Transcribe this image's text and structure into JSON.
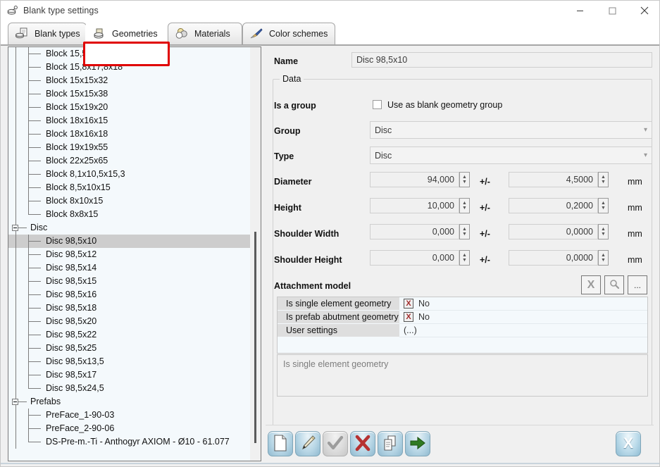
{
  "window": {
    "title": "Blank type settings",
    "icon": "blank-settings-icon",
    "minimize": "minimize-icon",
    "maximize": "maximize-icon",
    "close": "close-icon"
  },
  "tabs": [
    {
      "label": "Blank types",
      "icon": "blank-stack-icon",
      "selected": false
    },
    {
      "label": "Geometries",
      "icon": "geometry-disc-icon",
      "selected": true
    },
    {
      "label": "Materials",
      "icon": "materials-discs-icon",
      "selected": false
    },
    {
      "label": "Color schemes",
      "icon": "paintbrush-icon",
      "selected": false
    }
  ],
  "highlight_color": "#e00000",
  "tree": {
    "items": [
      {
        "label": "Block 15,5x19x39",
        "level": 1,
        "selected": false
      },
      {
        "label": "Block 15,8x17,8x18",
        "level": 1,
        "selected": false
      },
      {
        "label": "Block 15x15x32",
        "level": 1,
        "selected": false
      },
      {
        "label": "Block 15x15x38",
        "level": 1,
        "selected": false
      },
      {
        "label": "Block 15x19x20",
        "level": 1,
        "selected": false
      },
      {
        "label": "Block 18x16x15",
        "level": 1,
        "selected": false
      },
      {
        "label": "Block 18x16x18",
        "level": 1,
        "selected": false
      },
      {
        "label": "Block 19x19x55",
        "level": 1,
        "selected": false
      },
      {
        "label": "Block 22x25x65",
        "level": 1,
        "selected": false
      },
      {
        "label": "Block 8,1x10,5x15,3",
        "level": 1,
        "selected": false
      },
      {
        "label": "Block 8,5x10x15",
        "level": 1,
        "selected": false
      },
      {
        "label": "Block 8x10x15",
        "level": 1,
        "selected": false
      },
      {
        "label": "Block 8x8x15",
        "level": 1,
        "selected": false,
        "last": true
      },
      {
        "label": "Disc",
        "level": 0,
        "expanded": true,
        "selected": false
      },
      {
        "label": "Disc 98,5x10",
        "level": 1,
        "selected": true
      },
      {
        "label": "Disc 98,5x12",
        "level": 1,
        "selected": false
      },
      {
        "label": "Disc 98,5x14",
        "level": 1,
        "selected": false
      },
      {
        "label": "Disc 98,5x15",
        "level": 1,
        "selected": false
      },
      {
        "label": "Disc 98,5x16",
        "level": 1,
        "selected": false
      },
      {
        "label": "Disc 98,5x18",
        "level": 1,
        "selected": false
      },
      {
        "label": "Disc 98,5x20",
        "level": 1,
        "selected": false
      },
      {
        "label": "Disc 98,5x22",
        "level": 1,
        "selected": false
      },
      {
        "label": "Disc 98,5x25",
        "level": 1,
        "selected": false
      },
      {
        "label": "Disc 98,5x13,5",
        "level": 1,
        "selected": false
      },
      {
        "label": "Disc 98,5x17",
        "level": 1,
        "selected": false
      },
      {
        "label": "Disc 98,5x24,5",
        "level": 1,
        "selected": false,
        "last": true
      },
      {
        "label": "Prefabs",
        "level": 0,
        "expanded": true,
        "selected": false
      },
      {
        "label": "PreFace_1-90-03",
        "level": 1,
        "selected": false
      },
      {
        "label": "PreFace_2-90-06",
        "level": 1,
        "selected": false
      },
      {
        "label": "DS-Pre-m.-Ti - Anthogyr AXIOM - Ø10 - 61.077",
        "level": 1,
        "selected": false,
        "last": true
      }
    ]
  },
  "form": {
    "name_label": "Name",
    "name_value": "Disc 98,5x10",
    "group_title": "Data",
    "is_group_label": "Is a group",
    "is_group_checkbox_label": "Use as blank geometry group",
    "is_group_checked": false,
    "group_label": "Group",
    "group_value": "Disc",
    "type_label": "Type",
    "type_value": "Disc",
    "unit": "mm",
    "plusminus": "+/-",
    "numeric_rows": [
      {
        "label": "Diameter",
        "value": "94,000",
        "tolerance": "4,5000",
        "unit": "mm"
      },
      {
        "label": "Height",
        "value": "10,000",
        "tolerance": "0,2000",
        "unit": "mm"
      },
      {
        "label": "Shoulder Width",
        "value": "0,000",
        "tolerance": "0,0000",
        "unit": "mm"
      },
      {
        "label": "Shoulder Height",
        "value": "0,000",
        "tolerance": "0,0000",
        "unit": "mm"
      }
    ],
    "attachment_label": "Attachment model",
    "attachment_buttons": [
      {
        "name": "clear-attachment-button",
        "glyph": "X"
      },
      {
        "name": "preview-attachment-button",
        "glyph": "search"
      },
      {
        "name": "browse-attachment-button",
        "glyph": "..."
      }
    ],
    "properties": [
      {
        "name": "Is single element geometry",
        "value": "No",
        "has_x": true
      },
      {
        "name": "Is prefab abutment geometry",
        "value": "No",
        "has_x": true
      },
      {
        "name": "User settings",
        "value": "(...)",
        "has_x": false
      }
    ],
    "description": "Is single element geometry"
  },
  "toolbar": {
    "buttons": [
      {
        "name": "new-button",
        "icon": "new-document-icon",
        "enabled": true
      },
      {
        "name": "edit-button",
        "icon": "pencil-icon",
        "enabled": true
      },
      {
        "name": "accept-button",
        "icon": "checkmark-icon",
        "enabled": false
      },
      {
        "name": "delete-button",
        "icon": "red-x-icon",
        "enabled": true
      },
      {
        "name": "copy-button",
        "icon": "copy-pages-icon",
        "enabled": true
      },
      {
        "name": "export-button",
        "icon": "green-arrow-icon",
        "enabled": true
      }
    ],
    "close_label": "X",
    "close_name": "close-dialog-button"
  }
}
